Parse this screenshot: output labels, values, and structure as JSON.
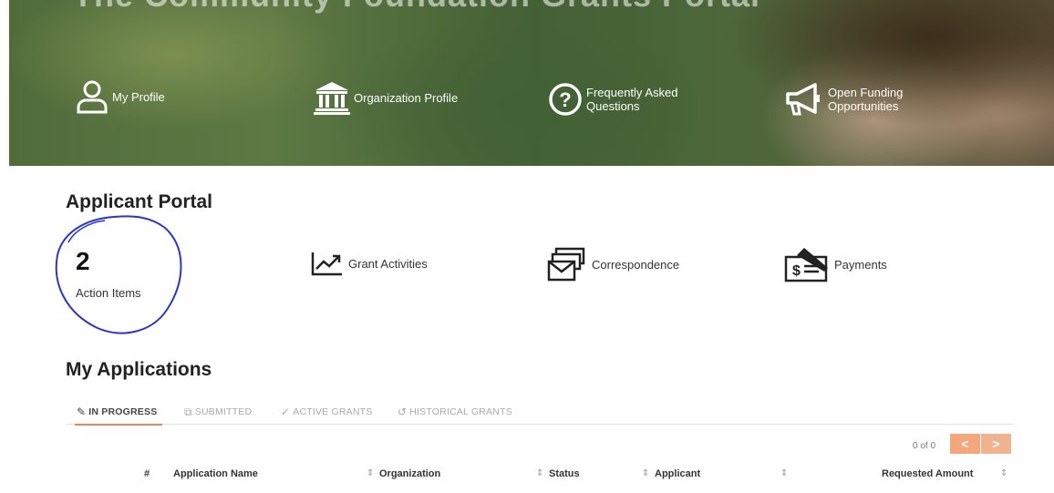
{
  "hero": {
    "title_clip": "The Community Foundation Grants Portal",
    "links": {
      "my_profile": "My Profile",
      "organization_profile": "Organization Profile",
      "faq": "Frequently Asked Questions",
      "open_funding": "Open Funding Opportunities"
    },
    "icons": {
      "my_profile": "user-outline-icon",
      "organization_profile": "bank-building-icon",
      "faq": "question-circle-icon",
      "open_funding": "megaphone-icon"
    }
  },
  "portal": {
    "title": "Applicant Portal",
    "action_items": {
      "count": "2",
      "label": "Action Items"
    },
    "links": {
      "grant_activities": "Grant Activities",
      "correspondence": "Correspondence",
      "payments": "Payments"
    },
    "icons": {
      "grant_activities": "trend-chart-icon",
      "correspondence": "mail-stack-icon",
      "payments": "check-payment-icon"
    }
  },
  "applications": {
    "title": "My Applications",
    "tabs": [
      {
        "label": "IN PROGRESS",
        "icon": "edit-icon",
        "active": true
      },
      {
        "label": "SUBMITTED",
        "icon": "external-link-icon",
        "active": false
      },
      {
        "label": "ACTIVE GRANTS",
        "icon": "check-icon",
        "active": false
      },
      {
        "label": "HISTORICAL GRANTS",
        "icon": "history-icon",
        "active": false
      }
    ],
    "pager": {
      "text": "0 of 0",
      "prev": "<",
      "next": ">"
    },
    "columns": [
      "#",
      "Application Name",
      "Organization",
      "Status",
      "Applicant",
      "Requested Amount"
    ],
    "sort_glyph": "⇕"
  },
  "colors": {
    "accent": "#e8855a",
    "pager_button": "#f4a77d",
    "annotation_circle": "#2a36c8"
  }
}
